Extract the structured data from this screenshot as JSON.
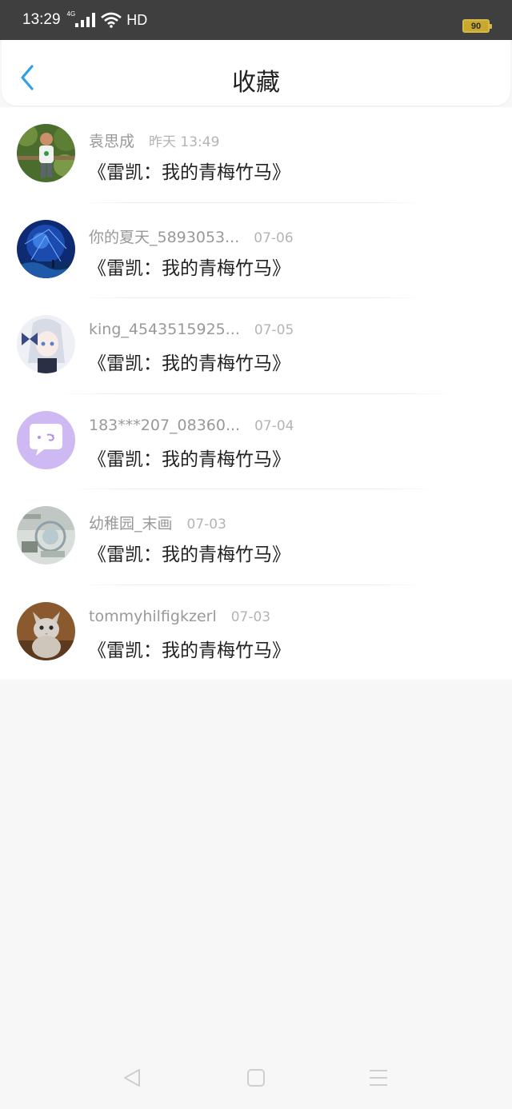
{
  "status_bar": {
    "time": "13:29",
    "network": "4G",
    "hd": "HD",
    "battery": "90"
  },
  "header": {
    "title": "收藏",
    "back_icon": "chevron-left-icon",
    "accent_color": "#2f9fe8"
  },
  "favorites": [
    {
      "user": "袁思成",
      "date": "昨天 13:49",
      "title": "《雷凯：我的青梅竹马》"
    },
    {
      "user": "你的夏天_5893053...",
      "date": "07-06",
      "title": "《雷凯：我的青梅竹马》"
    },
    {
      "user": "king_4543515925...",
      "date": "07-05",
      "title": "《雷凯：我的青梅竹马》"
    },
    {
      "user": "183***207_08360...",
      "date": "07-04",
      "title": "《雷凯：我的青梅竹马》"
    },
    {
      "user": "幼稚园_末画",
      "date": "07-03",
      "title": "《雷凯：我的青梅竹马》"
    },
    {
      "user": "tommyhilfigkzerl",
      "date": "07-03",
      "title": "《雷凯：我的青梅竹马》"
    }
  ],
  "nav_bar": {
    "icons": [
      "back-triangle-icon",
      "home-square-icon",
      "menu-lines-icon"
    ]
  }
}
